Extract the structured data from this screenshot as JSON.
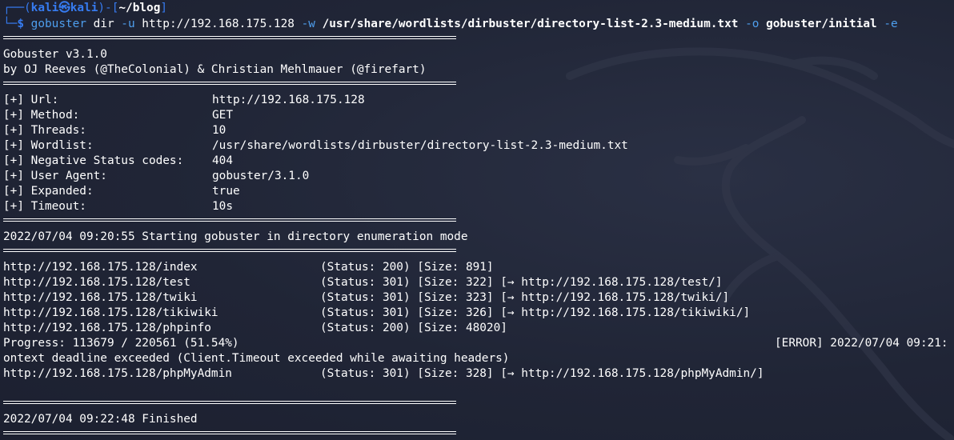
{
  "prompt": {
    "corner_top": "┌──(",
    "user": "kali",
    "at": "㉿",
    "host": "kali",
    "close_paren": ")-[",
    "path": "~/blog",
    "close_bracket": "]",
    "corner_bottom": "└─",
    "dollar": "$",
    "cmd": "gobuster",
    "arg1": " dir",
    "flag_u": " -u",
    "url": " http://192.168.175.128",
    "flag_w": " -w",
    "wordlist": " /usr/share/wordlists/dirbuster/directory-list-2.3-medium.txt",
    "flag_o": " -o",
    "outfile": " gobuster/initial",
    "flag_e": " -e"
  },
  "banner": {
    "version": "Gobuster v3.1.0",
    "authors": "by OJ Reeves (@TheColonial) & Christian Mehlmauer (@firefart)"
  },
  "config": [
    {
      "key": "[+] Url:",
      "value": "http://192.168.175.128"
    },
    {
      "key": "[+] Method:",
      "value": "GET"
    },
    {
      "key": "[+] Threads:",
      "value": "10"
    },
    {
      "key": "[+] Wordlist:",
      "value": "/usr/share/wordlists/dirbuster/directory-list-2.3-medium.txt"
    },
    {
      "key": "[+] Negative Status codes:",
      "value": "404"
    },
    {
      "key": "[+] User Agent:",
      "value": "gobuster/3.1.0"
    },
    {
      "key": "[+] Expanded:",
      "value": "true"
    },
    {
      "key": "[+] Timeout:",
      "value": "10s"
    }
  ],
  "start_msg": "2022/07/04 09:20:55 Starting gobuster in directory enumeration mode",
  "results": [
    {
      "url": "http://192.168.175.128/index",
      "info": "(Status: 200) [Size: 891]"
    },
    {
      "url": "http://192.168.175.128/test",
      "info": "(Status: 301) [Size: 322] [→ http://192.168.175.128/test/]"
    },
    {
      "url": "http://192.168.175.128/twiki",
      "info": "(Status: 301) [Size: 323] [→ http://192.168.175.128/twiki/]"
    },
    {
      "url": "http://192.168.175.128/tikiwiki",
      "info": "(Status: 301) [Size: 326] [→ http://192.168.175.128/tikiwiki/]"
    },
    {
      "url": "http://192.168.175.128/phpinfo",
      "info": "(Status: 200) [Size: 48020]"
    }
  ],
  "progress": {
    "text": "Progress: 113679 / 220561 (51.54%)",
    "error": "[ERROR] 2022/07/04 09:21:"
  },
  "error_cont": "ontext deadline exceeded (Client.Timeout exceeded while awaiting headers)",
  "last_result": {
    "url": "http://192.168.175.128/phpMyAdmin",
    "info": "(Status: 301) [Size: 328] [→ http://192.168.175.128/phpMyAdmin/]"
  },
  "finished": "2022/07/04 09:22:48 Finished",
  "colors": {
    "background": "#1f2434",
    "prompt_blue": "#367bf0",
    "flag_blue": "#4e9eed",
    "text": "#ffffff"
  }
}
